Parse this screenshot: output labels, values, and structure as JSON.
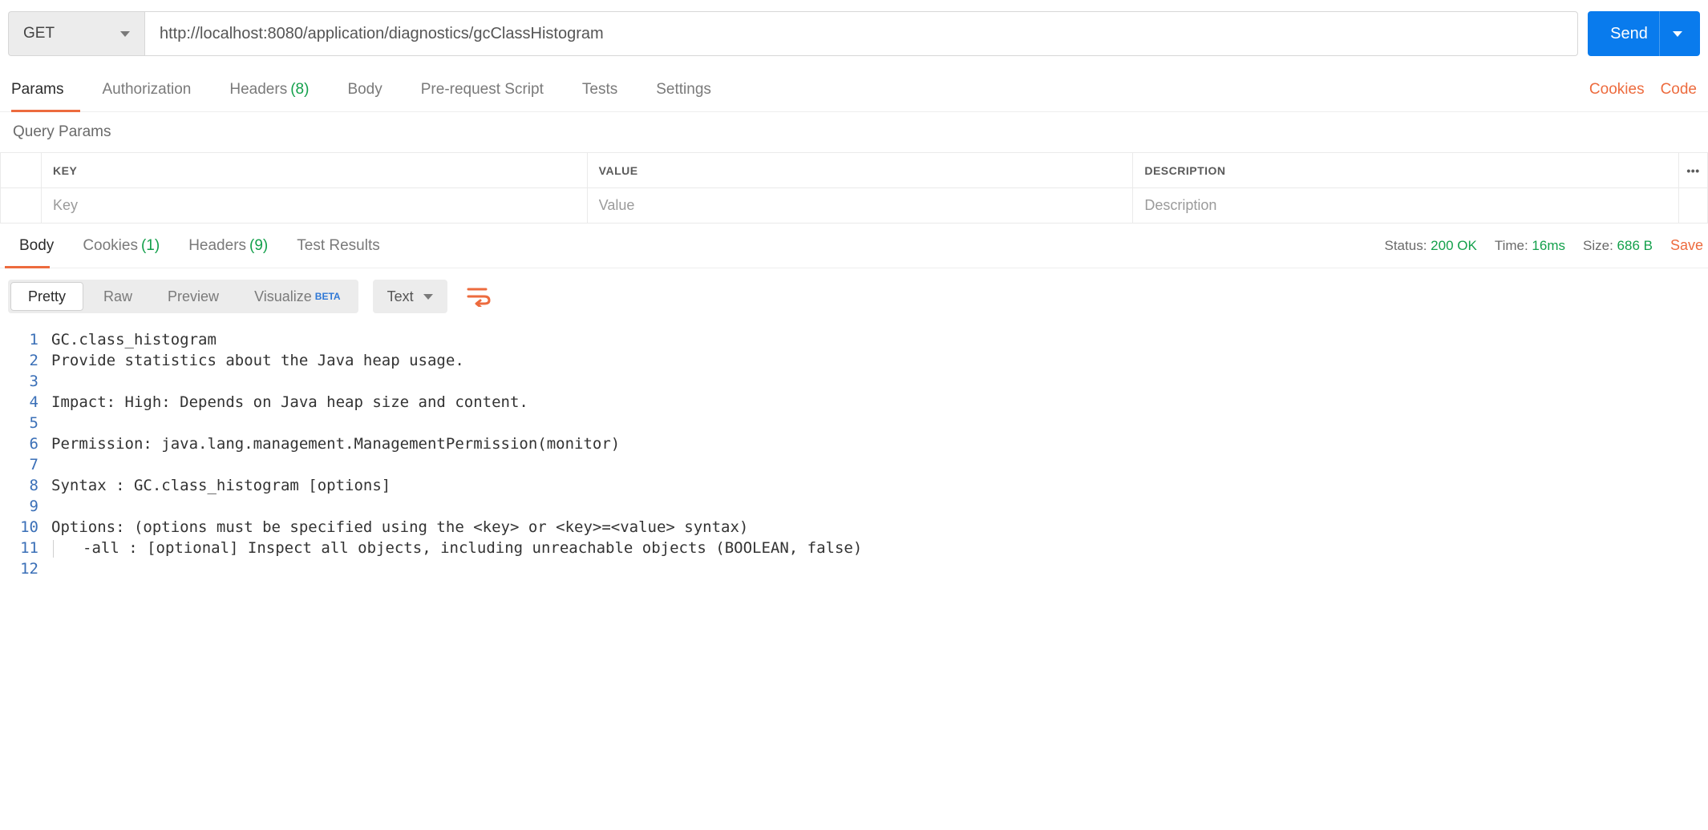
{
  "request": {
    "method": "GET",
    "url": "http://localhost:8080/application/diagnostics/gcClassHistogram",
    "send_label": "Send"
  },
  "request_tabs": {
    "params": "Params",
    "authorization": "Authorization",
    "headers": "Headers",
    "headers_count": "(8)",
    "body": "Body",
    "prerequest": "Pre-request Script",
    "tests": "Tests",
    "settings": "Settings"
  },
  "links": {
    "cookies": "Cookies",
    "code": "Code"
  },
  "section_label": "Query Params",
  "params_header": {
    "key": "KEY",
    "value": "VALUE",
    "desc": "DESCRIPTION"
  },
  "params_placeholders": {
    "key": "Key",
    "value": "Value",
    "desc": "Description"
  },
  "dots": "•••",
  "response_tabs": {
    "body": "Body",
    "cookies": "Cookies",
    "cookies_count": "(1)",
    "headers": "Headers",
    "headers_count": "(9)",
    "test_results": "Test Results"
  },
  "response_meta": {
    "status_label": "Status:",
    "status_value": "200 OK",
    "time_label": "Time:",
    "time_value": "16ms",
    "size_label": "Size:",
    "size_value": "686 B",
    "save": "Save"
  },
  "view_modes": {
    "pretty": "Pretty",
    "raw": "Raw",
    "preview": "Preview",
    "visualize": "Visualize",
    "beta": "BETA"
  },
  "format_select": "Text",
  "body_lines": [
    "GC.class_histogram",
    "Provide statistics about the Java heap usage.",
    "",
    "Impact: High: Depends on Java heap size and content.",
    "",
    "Permission: java.lang.management.ManagementPermission(monitor)",
    "",
    "Syntax : GC.class_histogram [options]",
    "",
    "Options: (options must be specified using the <key> or <key>=<value> syntax)",
    "    -all : [optional] Inspect all objects, including unreachable objects (BOOLEAN, false)",
    ""
  ]
}
